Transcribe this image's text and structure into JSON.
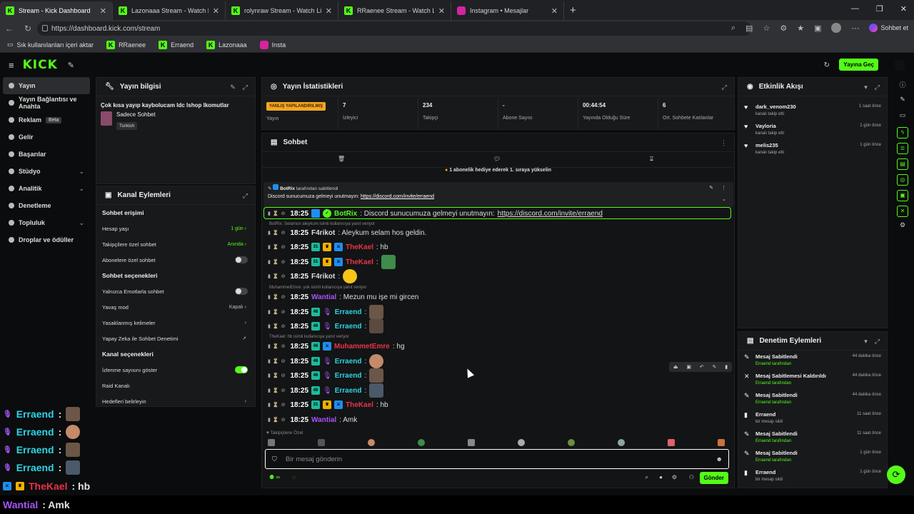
{
  "browser": {
    "tabs": [
      {
        "title": "Stream - Kick Dashboard",
        "fav": "K"
      },
      {
        "title": "Lazonaaa Stream - Watch Live on K",
        "fav": "K"
      },
      {
        "title": "rolynraw Stream - Watch Live on K",
        "fav": "K"
      },
      {
        "title": "RRaenee Stream - Watch Live on K",
        "fav": "K"
      },
      {
        "title": "Instagram • Mesajlar",
        "fav": "ig"
      }
    ],
    "url": "https://dashboard.kick.com/stream",
    "profile_label": "Sohbet et",
    "bookmarks": [
      "Sık kullanılanları içeri aktar",
      "RRaenee",
      "Erraend",
      "Lazonaaa",
      "Insta"
    ]
  },
  "topbar": {
    "logo": "KICK",
    "go_live": "Yayına Geç"
  },
  "sidebar": {
    "items": [
      {
        "label": "Yayın",
        "active": true
      },
      {
        "label": "Yayın Bağlantısı ve Anahta",
        "active": false
      },
      {
        "label": "Reklam",
        "badge": "Beta"
      },
      {
        "label": "Gelir"
      },
      {
        "label": "Başarılar"
      },
      {
        "label": "Stüdyo",
        "chevron": true
      },
      {
        "label": "Analitik",
        "chevron": true
      },
      {
        "label": "Denetleme"
      },
      {
        "label": "Topluluk",
        "chevron": true
      },
      {
        "label": "Droplar ve ödüller"
      }
    ]
  },
  "stream_info": {
    "header": "Yayın bilgisi",
    "title": "Çok kısa yayıp kaybolucam ldc lshop lkomutlar",
    "category": "Sadece Sohbet",
    "tag": "Turkish"
  },
  "channel_actions": {
    "header": "Kanal Eylemleri",
    "sections": [
      {
        "title": "Sohbet erişimi",
        "rows": [
          {
            "label": "Hesap yaşı",
            "value": "1 gün",
            "green": true,
            "chevron": true
          },
          {
            "label": "Takipçilere özel sohbet",
            "value": "Anında",
            "green": true,
            "chevron": true
          },
          {
            "label": "Abonelere özel sohbet",
            "toggle": false
          }
        ]
      },
      {
        "title": "Sohbet seçenekleri",
        "rows": [
          {
            "label": "Yalnızca Emotlarla sohbet",
            "toggle": false
          },
          {
            "label": "Yavaş mod",
            "value": "Kapalı",
            "chevron": true
          },
          {
            "label": "Yasaklanmış kelimeler",
            "chevron": true
          },
          {
            "label": "Yapay Zeka ile Sohbet Denetimi",
            "ext": true
          }
        ]
      },
      {
        "title": "Kanal seçenekleri",
        "rows": [
          {
            "label": "İzlenme sayısını göster",
            "toggle": true
          },
          {
            "label": "Raid Kanalı"
          },
          {
            "label": "Hedefleri belirleyin",
            "chevron": true
          }
        ]
      }
    ]
  },
  "stats": {
    "header": "Yayın İstatistikleri",
    "warning": "YANLIŞ YAPILANDIRILMIŞ",
    "warning_label": "Yayın",
    "items": [
      {
        "value": "7",
        "label": "İzleyici"
      },
      {
        "value": "234",
        "label": "Takipçi"
      },
      {
        "value": "-",
        "label": "Abone Sayısı"
      },
      {
        "value": "00:44:54",
        "label": "Yayında Olduğu Süre"
      },
      {
        "value": "6",
        "label": "Ort. Sohbete Katılanlar"
      }
    ]
  },
  "chat": {
    "header": "Sohbet",
    "announce": "1 abonelik hediye ederek 1. sıraya yükselin",
    "pinned_by": "BotRix",
    "pinned_suffix": "tarafından sabitlendi",
    "pinned_msg": "Discord sunucumuza gelmeyi unutmayın:",
    "pinned_link": "https://discord.com/invite/erraend",
    "messages": [
      {
        "time": "18:25",
        "user": "BotRix",
        "color": "#53fc18",
        "text": ": Discord sunucumuza gelmeyi unutmayın: ",
        "link": "https://discord.com/invite/erraend"
      },
      {
        "reply": "BotRix: Selamun aleykum isimli kullanıcıya yanıt veriyor"
      },
      {
        "time": "18:25",
        "user": "F4rikot",
        "color": "#ffffff",
        "text": ": Aleykum selam hos geldin."
      },
      {
        "time": "18:25",
        "user": "TheKael",
        "color": "#e8334a",
        "text": ": hb"
      },
      {
        "time": "18:25",
        "user": "TheKael",
        "color": "#e8334a",
        "text": ":"
      },
      {
        "time": "18:25",
        "user": "F4rikot",
        "color": "#ffffff",
        "text": ":"
      },
      {
        "reply": "MuhammetEmre: yok isimli kullanıcıya yanıt veriyor"
      },
      {
        "time": "18:25",
        "user": "Wantial",
        "color": "#a855f7",
        "text": ": Mezun mu işe mi gircen"
      },
      {
        "time": "18:25",
        "user": "Erraend",
        "color": "#2dd4e6",
        "text": ":"
      },
      {
        "time": "18:25",
        "user": "Erraend",
        "color": "#2dd4e6",
        "text": ":"
      },
      {
        "reply": "TheKael: hb isimli kullanıcıya yanıt veriyor"
      },
      {
        "time": "18:25",
        "user": "MuhammetEmre",
        "color": "#e8334a",
        "text": ": hg"
      },
      {
        "time": "18:25",
        "user": "Erraend",
        "color": "#2dd4e6",
        "text": ":"
      },
      {
        "time": "18:25",
        "user": "Erraend",
        "color": "#2dd4e6",
        "text": ":"
      },
      {
        "time": "18:25",
        "user": "Erraend",
        "color": "#2dd4e6",
        "text": ":"
      },
      {
        "time": "18:25",
        "user": "TheKael",
        "color": "#e8334a",
        "text": ": hb"
      },
      {
        "time": "18:25",
        "user": "Wantial",
        "color": "#a855f7",
        "text": ": Amk"
      }
    ],
    "followers_only": "Takipçilere Özel",
    "placeholder": "Bir mesaj gönderin",
    "send": "Gönder"
  },
  "activity": {
    "header": "Etkinlik Akışı",
    "items": [
      {
        "name": "dark_venom230",
        "sub": "kanalı takip etti",
        "time": "1 saat önce"
      },
      {
        "name": "Vayloria",
        "sub": "kanalı takip etti",
        "time": "1 gün önce"
      },
      {
        "name": "melis235",
        "sub": "kanalı takip etti",
        "time": "1 gün önce"
      }
    ]
  },
  "moderation": {
    "header": "Denetim Eylemleri",
    "items": [
      {
        "name": "Mesaj Sabitlendi",
        "sub": "Erraend tarafından",
        "time": "44 dakika önce"
      },
      {
        "name": "Mesaj Sabitlemesi Kaldırıldı",
        "sub": "Erraend tarafından",
        "time": "44 dakika önce"
      },
      {
        "name": "Mesaj Sabitlendi",
        "sub": "Erraend tarafından",
        "time": "44 dakika önce"
      },
      {
        "name": "Erraend",
        "sub": "bir mesajı sildi",
        "time": "11 saat önce"
      },
      {
        "name": "Mesaj Sabitlendi",
        "sub": "Erraend tarafından",
        "time": "11 saat önce"
      },
      {
        "name": "Mesaj Sabitlendi",
        "sub": "Erraend tarafından",
        "time": "1 gün önce"
      },
      {
        "name": "Erraend",
        "sub": "bir mesajı sildi",
        "time": "1 gün önce"
      }
    ]
  },
  "overlay": [
    {
      "user": "Erraend",
      "color": "#2dd4e6",
      "text": ":"
    },
    {
      "user": "Erraend",
      "color": "#2dd4e6",
      "text": ":"
    },
    {
      "user": "Erraend",
      "color": "#2dd4e6",
      "text": ":"
    },
    {
      "user": "Erraend",
      "color": "#2dd4e6",
      "text": ":"
    },
    {
      "user": "TheKael",
      "color": "#e8334a",
      "text": ": hb"
    },
    {
      "user": "Wantial",
      "color": "#a855f7",
      "text": ": Amk"
    }
  ]
}
